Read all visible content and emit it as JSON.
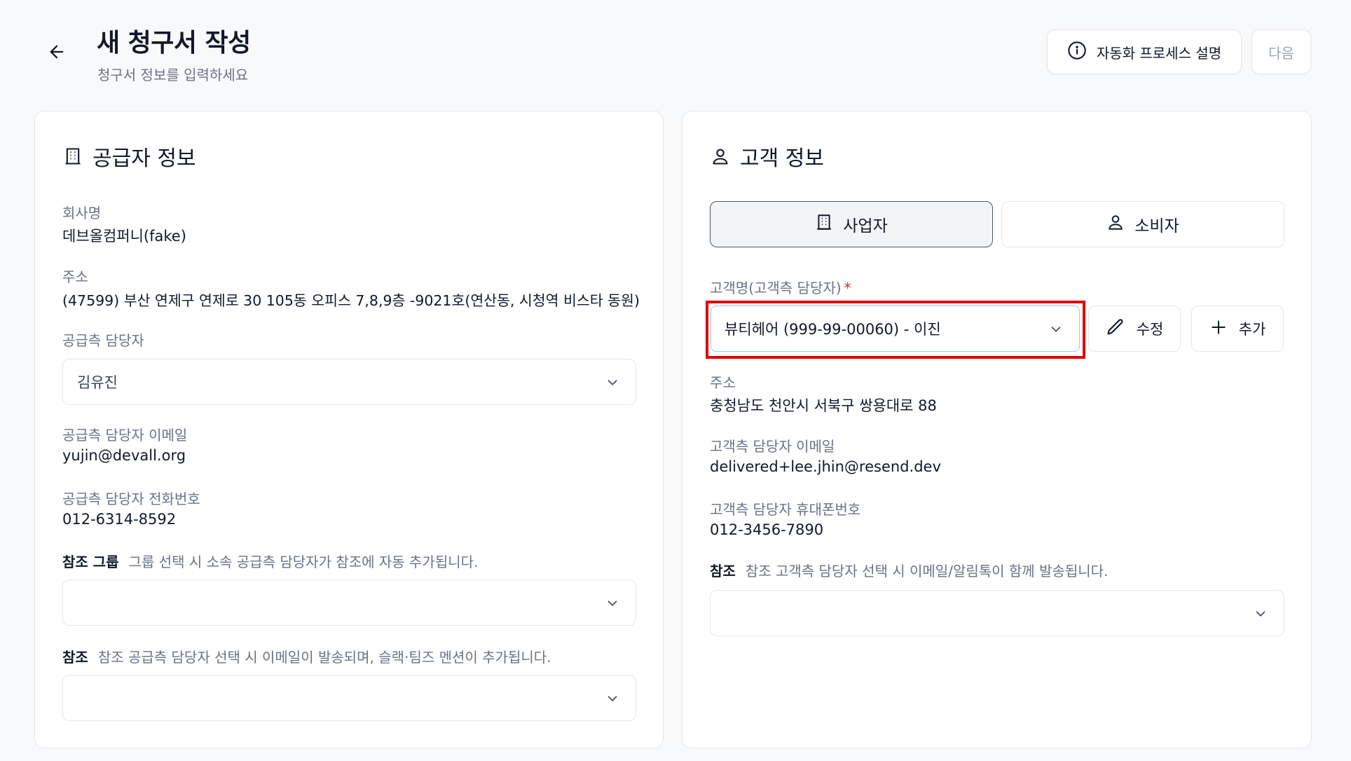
{
  "header": {
    "title": "새 청구서 작성",
    "subtitle": "청구서 정보를 입력하세요",
    "process_button": "자동화 프로세스 설명",
    "next_button": "다음"
  },
  "supplier": {
    "title": "공급자 정보",
    "company_label": "회사명",
    "company_value": "데브올컴퍼니(fake)",
    "address_label": "주소",
    "address_value": "(47599) 부산 연제구 연제로 30 105동 오피스 7,8,9층 -9021호(연산동, 시청역 비스타 동원)",
    "manager_label": "공급측 담당자",
    "manager_value": "김유진",
    "email_label": "공급측 담당자 이메일",
    "email_value": "yujin@devall.org",
    "phone_label": "공급측 담당자 전화번호",
    "phone_value": "012-6314-8592",
    "ref_group_label": "참조 그룹",
    "ref_group_hint": "그룹 선택 시 소속 공급측 담당자가 참조에 자동 추가됩니다.",
    "ref_label": "참조",
    "ref_hint": "참조 공급측 담당자 선택 시 이메일이 발송되며, 슬랙·팀즈 멘션이 추가됩니다."
  },
  "customer": {
    "title": "고객 정보",
    "type_business": "사업자",
    "type_consumer": "소비자",
    "name_label": "고객명(고객측 담당자)",
    "required_mark": "*",
    "name_value": "뷰티헤어 (999-99-00060) - 이진",
    "edit_button": "수정",
    "add_button": "추가",
    "address_label": "주소",
    "address_value": "충청남도 천안시 서북구 쌍용대로 88",
    "email_label": "고객측 담당자 이메일",
    "email_value": "delivered+lee.jhin@resend.dev",
    "phone_label": "고객측 담당자 휴대폰번호",
    "phone_value": "012-3456-7890",
    "ref_label": "참조",
    "ref_hint": "참조 고객측 담당자 선택 시 이메일/알림톡이 함께 발송됩니다."
  },
  "colors": {
    "highlight": "#e00000",
    "required": "#dc2626",
    "muted_text": "#6b7280"
  },
  "icons": {
    "back": "arrow-left-icon",
    "info": "info-circle-icon",
    "building": "building-icon",
    "user": "user-icon",
    "chevron": "chevron-down-icon",
    "pencil": "pencil-icon",
    "plus": "plus-icon"
  }
}
